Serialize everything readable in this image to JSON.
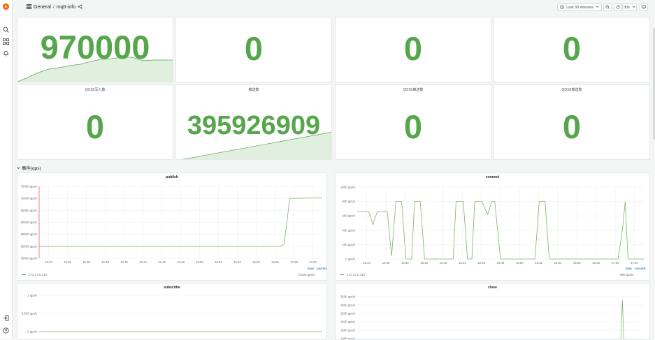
{
  "breadcrumb": {
    "folder": "General",
    "separator": "/",
    "dashboard": "mqtt-info"
  },
  "toolbar": {
    "time_range": "Last 30 minutes",
    "refresh_interval": "30s"
  },
  "sidebar": {
    "icons": [
      "grafana-logo-icon",
      "search-icon",
      "dashboards-icon",
      "alerting-bell-icon",
      "sign-in-icon",
      "help-icon"
    ]
  },
  "stats_row1": [
    {
      "value": "970000",
      "title": ""
    },
    {
      "value": "0",
      "title": ""
    },
    {
      "value": "0",
      "title": ""
    },
    {
      "value": "0",
      "title": ""
    }
  ],
  "stats_row2": [
    {
      "title": "QOS2写入数",
      "value": "0"
    },
    {
      "title": "推送数",
      "value": "395926909"
    },
    {
      "title": "QOS1推送数",
      "value": "0"
    },
    {
      "title": "QOS2推送数",
      "value": "0"
    }
  ],
  "row_title": "事件(qps)",
  "graphs": {
    "publish": {
      "title": "publish",
      "legend_series": "172.17.6.110",
      "legend_headers": [
        "max",
        "current"
      ],
      "legend_current": "70225 qps/s"
    },
    "connect": {
      "title": "connect",
      "legend_series": "172.17.6.110",
      "legend_headers": [
        "max",
        "current"
      ],
      "legend_current": "880 qps/s"
    },
    "subscribe": {
      "title": "subscribe"
    },
    "close": {
      "title": "close"
    }
  },
  "colors": {
    "accent_green": "#56a64b",
    "link_blue": "#3274d9",
    "logo_orange": "#f05a28"
  },
  "chart_data": [
    {
      "type": "line",
      "title": "publish",
      "x": [
        "16:34",
        "16:36",
        "16:38",
        "16:40",
        "16:42",
        "16:44",
        "16:46",
        "16:48",
        "16:50",
        "16:52",
        "16:54",
        "16:56",
        "16:58",
        "17:00",
        "17:02"
      ],
      "yticks": [
        "45000 qps/s",
        "50000 qps/s",
        "55000 qps/s",
        "60000 qps/s",
        "65000 qps/s",
        "70000 qps/s",
        "75000 qps/s"
      ],
      "ylim": [
        45000,
        75000
      ],
      "series": [
        {
          "name": "172.17.6.110",
          "points": [
            [
              0,
              50000
            ],
            [
              0.855,
              50000
            ],
            [
              0.865,
              51000
            ],
            [
              0.875,
              60000
            ],
            [
              0.885,
              70000
            ],
            [
              1.0,
              70225
            ]
          ]
        }
      ]
    },
    {
      "type": "line",
      "title": "connect",
      "x": [
        "16:34",
        "16:36",
        "16:38",
        "16:40",
        "16:42",
        "16:44",
        "16:46",
        "16:48",
        "16:50",
        "16:52",
        "16:54",
        "16:56",
        "16:58",
        "17:00",
        "17:02"
      ],
      "yticks": [
        "0 qps/s",
        "200 qps/s",
        "400 qps/s",
        "600 qps/s",
        "800 qps/s",
        "1000 qps/s"
      ],
      "ylim": [
        0,
        1000
      ],
      "series": [
        {
          "name": "172.17.6.110",
          "points": [
            [
              0,
              660
            ],
            [
              0.04,
              660
            ],
            [
              0.055,
              480
            ],
            [
              0.07,
              660
            ],
            [
              0.105,
              660
            ],
            [
              0.12,
              40
            ],
            [
              0.135,
              800
            ],
            [
              0.155,
              800
            ],
            [
              0.17,
              0
            ],
            [
              0.19,
              0
            ],
            [
              0.2,
              800
            ],
            [
              0.22,
              800
            ],
            [
              0.235,
              0
            ],
            [
              0.335,
              0
            ],
            [
              0.345,
              800
            ],
            [
              0.37,
              800
            ],
            [
              0.385,
              0
            ],
            [
              0.4,
              0
            ],
            [
              0.41,
              800
            ],
            [
              0.435,
              800
            ],
            [
              0.455,
              620
            ],
            [
              0.47,
              800
            ],
            [
              0.48,
              800
            ],
            [
              0.5,
              0
            ],
            [
              0.62,
              0
            ],
            [
              0.635,
              800
            ],
            [
              0.655,
              800
            ],
            [
              0.67,
              0
            ],
            [
              0.91,
              0
            ],
            [
              0.925,
              400
            ],
            [
              0.935,
              800
            ],
            [
              0.945,
              0
            ],
            [
              1.0,
              0
            ]
          ]
        }
      ]
    },
    {
      "type": "line",
      "title": "subscribe",
      "yticks": [
        "0 qps/s",
        "0.500 qps/s",
        "1 qps/s"
      ],
      "ylim": [
        0,
        1
      ],
      "series": [
        {
          "name": "172.17.6.110",
          "points": [
            [
              0,
              0
            ],
            [
              1,
              0
            ]
          ]
        }
      ]
    },
    {
      "type": "line",
      "title": "close",
      "yticks": [
        "1000 qps/s",
        "1500 qps/s",
        "2000 qps/s",
        "2500 qps/s",
        "3000 qps/s",
        "3500 qps/s"
      ],
      "ylim": [
        1000,
        3500
      ],
      "series": [
        {
          "name": "172.17.6.110",
          "points": [
            [
              0.92,
              1000
            ],
            [
              0.925,
              3300
            ],
            [
              0.93,
              1000
            ]
          ]
        }
      ]
    }
  ]
}
